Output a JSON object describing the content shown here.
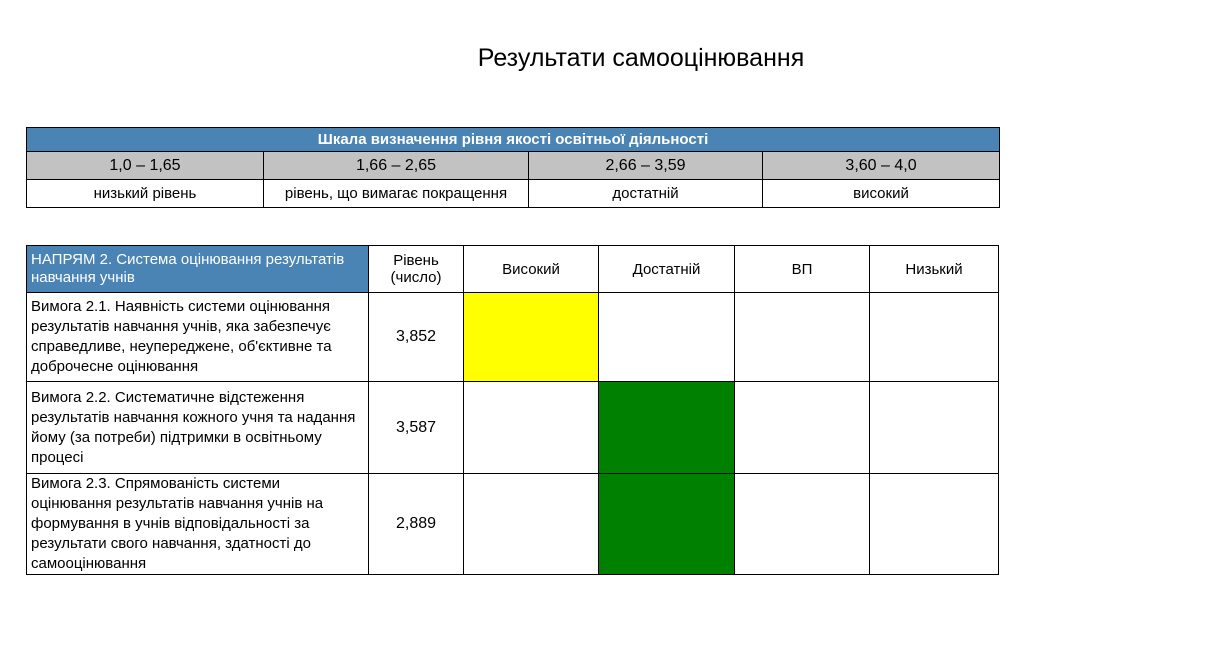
{
  "page": {
    "title": "Результати самооцінювання"
  },
  "scale": {
    "title": "Шкала визначення рівня якості освітньої діяльності",
    "ranges": [
      "1,0 – 1,65",
      "1,66 – 2,65",
      "2,66 – 3,59",
      "3,60 – 4,0"
    ],
    "levels": [
      "низький рівень",
      "рівень, що вимагає покращення",
      "достатній",
      "високий"
    ]
  },
  "results": {
    "direction": "НАПРЯМ 2. Система оцінювання результатів навчання учнів",
    "level_header": "Рівень (число)",
    "columns": [
      "Високий",
      "Достатній",
      "ВП",
      "Низький"
    ],
    "rows": [
      {
        "requirement": "Вимога 2.1. Наявність системи оцінювання результатів навчання учнів, яка забезпечує справедливе, неупереджене, об'єктивне та доброчесне оцінювання",
        "value": "3,852",
        "rating": "Високий"
      },
      {
        "requirement": "Вимога 2.2. Систематичне відстеження результатів навчання кожного учня та надання йому (за потреби) підтримки в освітньому процесі",
        "value": "3,587",
        "rating": "Достатній"
      },
      {
        "requirement": "Вимога 2.3. Спрямованість системи оцінювання результатів навчання учнів на формування в учнів відповідальності за результати свого навчання, здатності до самооцінювання",
        "value": "2,889",
        "rating": "Достатній"
      }
    ]
  },
  "colors": {
    "header_blue": "#4a84b4",
    "range_gray": "#c2c2c2",
    "high": "#ffff00",
    "sufficient": "#008000"
  }
}
